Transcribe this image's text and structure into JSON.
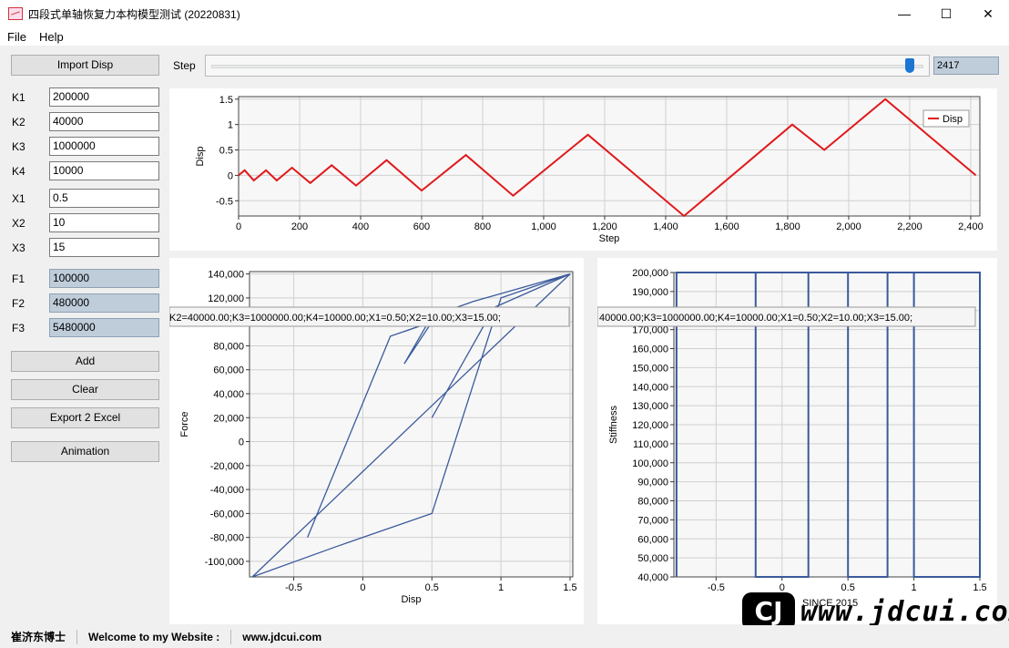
{
  "window": {
    "title": "四段式单轴恢复力本构模型测试 (20220831)",
    "minimize": "—",
    "maximize": "☐",
    "close": "✕"
  },
  "menu": [
    "File",
    "Help"
  ],
  "buttons": {
    "import": "Import Disp",
    "add": "Add",
    "clear": "Clear",
    "export": "Export 2 Excel",
    "animation": "Animation"
  },
  "params": [
    {
      "label": "K1",
      "value": "200000"
    },
    {
      "label": "K2",
      "value": "40000"
    },
    {
      "label": "K3",
      "value": "1000000"
    },
    {
      "label": "K4",
      "value": "10000"
    },
    {
      "label": "X1",
      "value": "0.5"
    },
    {
      "label": "X2",
      "value": "10"
    },
    {
      "label": "X3",
      "value": "15"
    }
  ],
  "forces": [
    {
      "label": "F1",
      "value": "100000"
    },
    {
      "label": "F2",
      "value": "480000"
    },
    {
      "label": "F3",
      "value": "5480000"
    }
  ],
  "step": {
    "label": "Step",
    "value": "2417",
    "fraction": 0.985
  },
  "status": {
    "author": "崔济东博士",
    "welcome": "Welcome to my Website :",
    "site": "www.jdcui.com"
  },
  "watermark": {
    "logo": "CJ",
    "text": "www.jdcui.com",
    "since": "SINCE 2015"
  },
  "chart_data": [
    {
      "type": "line",
      "xlabel": "Step",
      "ylabel": "Disp",
      "xlim": [
        0,
        2430
      ],
      "ylim": [
        -0.8,
        1.55
      ],
      "xticks": [
        "0",
        "200",
        "400",
        "600",
        "800",
        "1,000",
        "1,200",
        "1,400",
        "1,600",
        "1,800",
        "2,000",
        "2,200",
        "2,400"
      ],
      "yticks": [
        "-0.5",
        "0",
        "0.5",
        "1",
        "1.5"
      ],
      "legend": "top-right",
      "grid": true,
      "series": [
        {
          "name": "Disp",
          "color": "#e0191b",
          "x": [
            0,
            20,
            50,
            90,
            125,
            175,
            235,
            305,
            385,
            485,
            600,
            745,
            900,
            1145,
            1460,
            1815,
            1920,
            2120,
            2417
          ],
          "y": [
            0,
            0.1,
            -0.1,
            0.1,
            -0.1,
            0.15,
            -0.15,
            0.2,
            -0.2,
            0.3,
            -0.3,
            0.4,
            -0.4,
            0.8,
            -0.8,
            1.0,
            0.5,
            1.5,
            0
          ]
        }
      ]
    },
    {
      "type": "line",
      "xlabel": "Disp",
      "ylabel": "Force",
      "xlim": [
        -0.82,
        1.52
      ],
      "ylim": [
        -113000,
        142000
      ],
      "xticks": [
        "-0.5",
        "0",
        "0.5",
        "1",
        "1.5"
      ],
      "yticks": [
        "-100,000",
        "-80,000",
        "-60,000",
        "-40,000",
        "-20,000",
        "0",
        "20,000",
        "40,000",
        "60,000",
        "80,000",
        "100,000",
        "120,000",
        "140,000"
      ],
      "grid": true,
      "tooltip": "K2=40000.00;K3=1000000.00;K4=10000.00;X1=0.50;X2=10.00;X3=15.00;",
      "series": [
        {
          "color": "#3a5a9c",
          "x": [
            -0.4,
            0.2,
            0.45,
            0.3,
            0.5,
            0.3,
            0.5,
            0.8,
            1.5,
            -0.8,
            -0.2,
            0.0,
            0.5,
            1.0,
            1.5,
            0.95,
            0.5,
            0.5
          ],
          "y": [
            -80000,
            88000,
            98000,
            92000,
            100000,
            65000,
            105000,
            117000,
            140000,
            -113000,
            -88000,
            -80000,
            -60000,
            120000,
            140000,
            112000,
            20000,
            20000
          ]
        }
      ]
    },
    {
      "type": "line",
      "xlabel": "",
      "ylabel": "Stiffness",
      "xlim": [
        -0.82,
        1.5
      ],
      "ylim": [
        40000,
        200000
      ],
      "xticks": [
        "-0.5",
        "0",
        "0.5",
        "1",
        "1.5"
      ],
      "yticks": [
        "40,000",
        "50,000",
        "60,000",
        "70,000",
        "80,000",
        "90,000",
        "100,000",
        "110,000",
        "120,000",
        "130,000",
        "140,000",
        "150,000",
        "160,000",
        "170,000",
        "180,000",
        "190,000",
        "200,000"
      ],
      "grid": true,
      "tooltip": "40000.00;K3=1000000.00;K4=10000.00;X1=0.50;X2=10.00;X3=15.00;",
      "series": [
        {
          "color": "#3a5a9c",
          "x": [
            -0.8,
            -0.8,
            -0.2,
            -0.2,
            0.2,
            0.2,
            0.5,
            0.5,
            0.8,
            0.8,
            1.0,
            1.0,
            1.5,
            1.5,
            -0.8
          ],
          "y": [
            40000,
            200000,
            200000,
            40000,
            40000,
            200000,
            200000,
            40000,
            40000,
            200000,
            200000,
            40000,
            40000,
            200000,
            200000
          ]
        }
      ]
    }
  ]
}
